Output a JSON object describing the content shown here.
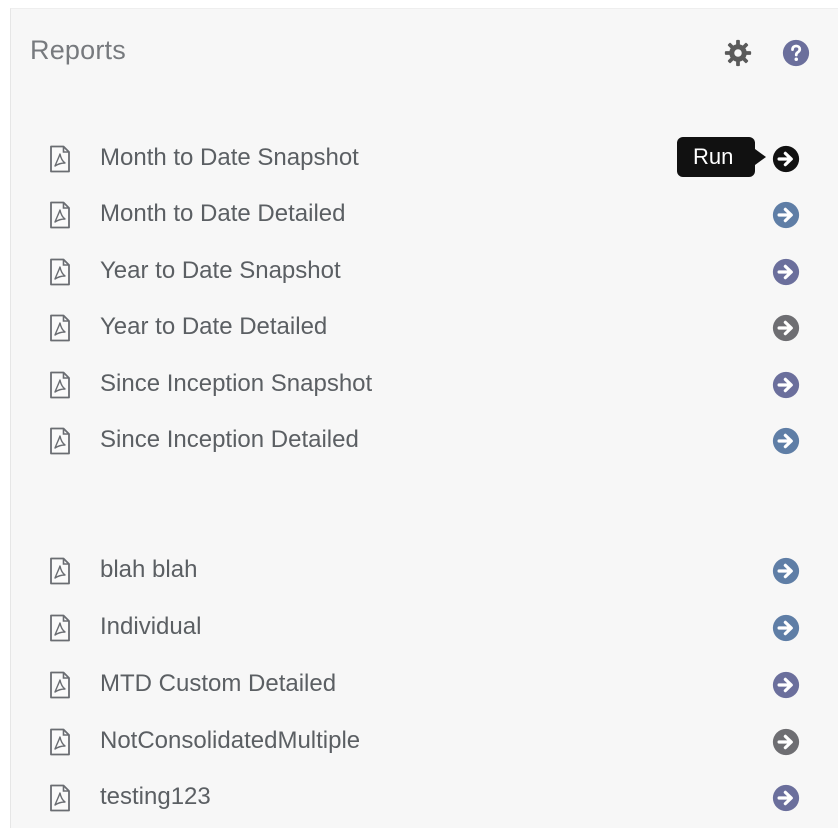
{
  "header": {
    "title": "Reports",
    "settings_icon": "gear-icon",
    "help_icon": "help-icon"
  },
  "tooltip": {
    "text": "Run"
  },
  "colors": {
    "panel_bg": "#f7f7f7",
    "run_blue": "#5f7ea6",
    "run_purple": "#6b6f9c",
    "run_gray": "#6e6e72",
    "run_active": "#111111",
    "label": "#5b5f63"
  },
  "standard_reports": [
    {
      "label": "Month to Date Snapshot",
      "run_icon": "run-arrow-icon",
      "active": true
    },
    {
      "label": "Month to Date Detailed",
      "run_icon": "run-arrow-icon"
    },
    {
      "label": "Year to Date Snapshot",
      "run_icon": "run-arrow-icon"
    },
    {
      "label": "Year to Date Detailed",
      "run_icon": "run-arrow-icon"
    },
    {
      "label": "Since Inception Snapshot",
      "run_icon": "run-arrow-icon"
    },
    {
      "label": "Since Inception Detailed",
      "run_icon": "run-arrow-icon"
    }
  ],
  "custom_reports": [
    {
      "label": "blah blah",
      "run_icon": "run-arrow-icon"
    },
    {
      "label": "Individual",
      "run_icon": "run-arrow-icon"
    },
    {
      "label": "MTD Custom Detailed",
      "run_icon": "run-arrow-icon"
    },
    {
      "label": "NotConsolidatedMultiple",
      "run_icon": "run-arrow-icon"
    },
    {
      "label": "testing123",
      "run_icon": "run-arrow-icon"
    }
  ]
}
